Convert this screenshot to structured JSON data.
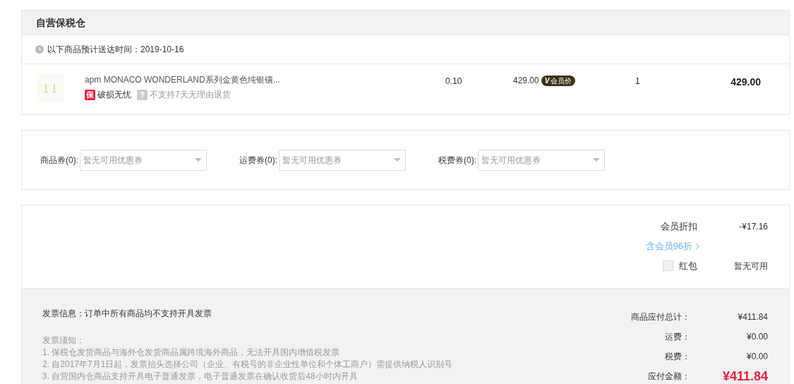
{
  "warehouse": {
    "title": "自营保税仓",
    "delivery_note": "以下商品预计送达时间：2019-10-16"
  },
  "items": [
    {
      "name": "apm MONACO WONDERLAND系列金黄色纯银镶...",
      "tags": [
        {
          "kind": "insurance",
          "icon": "保",
          "text": "破损无忧"
        },
        {
          "kind": "notice",
          "icon": "?",
          "text": "不支持7天无理由退货"
        }
      ],
      "weight": "0.10",
      "price": "429.00",
      "price_badge_mark": "V",
      "price_badge": "会员价",
      "quantity": "1",
      "amount": "429.00"
    }
  ],
  "coupons": [
    {
      "label": "商品券(0):",
      "placeholder": "暂无可用优惠券"
    },
    {
      "label": "运费券(0):",
      "placeholder": "暂无可用优惠券"
    },
    {
      "label": "税费券(0):",
      "placeholder": "暂无可用优惠券"
    }
  ],
  "discounts": {
    "member_label": "会员折扣",
    "member_value": "-¥17.16",
    "member_link": "含会员96折",
    "red_packet": {
      "label": "红包",
      "checked": false,
      "value": "暂无可用"
    }
  },
  "invoice": {
    "info": "发票信息：订单中所有商品均不支持开具发票",
    "notice_title": "发票须知：",
    "notices": [
      "1. 保税仓发货商品与海外仓发货商品属跨境海外商品，无法开具国内增值税发票",
      "2. 自2017年7月1日起，发票抬头选择公司（企业、有税号的非企业性单位和个体工商户）需提供纳税人识别号",
      "3. 自营国内仓商品支持开具电子普通发票，电子普通发票在确认收货后48小时内开具"
    ]
  },
  "totals": [
    {
      "kind": "normal",
      "label": "商品应付总计：",
      "value": "¥411.84"
    },
    {
      "kind": "normal",
      "label": "运费：",
      "value": "¥0.00"
    },
    {
      "kind": "normal",
      "label": "税费：",
      "value": "¥0.00"
    },
    {
      "kind": "grand",
      "label": "应付金额：",
      "value": "¥411.84"
    }
  ]
}
